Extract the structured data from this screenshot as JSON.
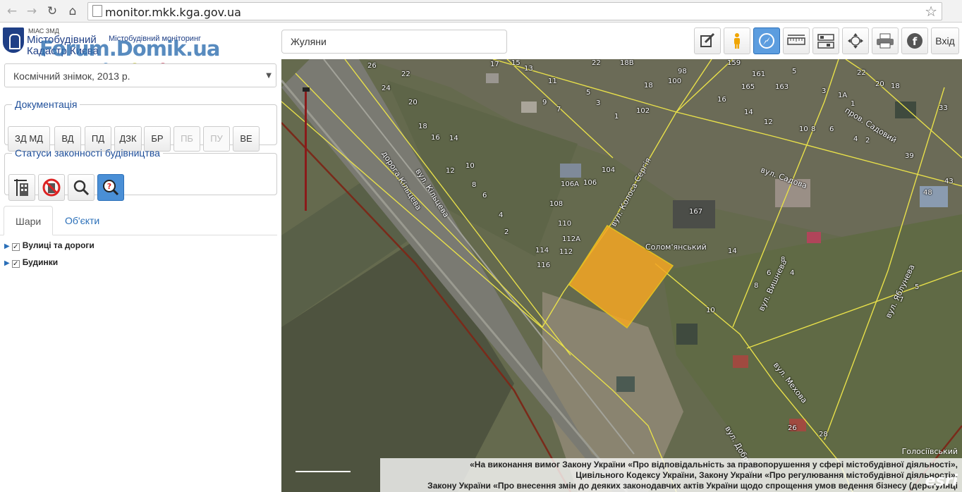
{
  "browser": {
    "url": "monitor.mkk.kga.gov.ua",
    "back_icon": "←",
    "forward_icon": "→",
    "reload_icon": "↻",
    "home_icon": "⌂",
    "star_icon": "☆"
  },
  "header": {
    "miac": "МІАС ЗМД",
    "brand_line1": "Містобудівний",
    "brand_line2": "Кадастр Києва",
    "subtitle": "Містобудівний моніторинг",
    "watermark": "Forum.Domik.ua"
  },
  "sidebar": {
    "basemap_selected": "Космічний знімок, 2013 р.",
    "documentation": {
      "legend": "Документація",
      "buttons": [
        "ЗД МД",
        "ВД",
        "ПД",
        "ДЗК",
        "БР",
        "ПБ",
        "ПУ",
        "ВЕ"
      ]
    },
    "statuses": {
      "legend": "Статуси законності будівництва"
    },
    "tabs": [
      "Шари",
      "Об'єкти"
    ],
    "layers": [
      "Вулиці та дороги",
      "Будинки"
    ]
  },
  "toolbar": {
    "search_value": "Жуляни",
    "login_label": "Вхід",
    "icons": [
      "edit-icon",
      "street-view-icon",
      "compass-icon",
      "ruler-icon",
      "layers-tool-icon",
      "pan-icon",
      "print-icon",
      "facebook-icon"
    ]
  },
  "map": {
    "streets": [
      "дорога Кільцева",
      "вул. Кільцева",
      "вул. Колоса Сергія",
      "вул. Садова",
      "пров. Садовий",
      "вул. Вишнева",
      "вул. Яблунева",
      "вул. Мехова",
      "вул. Доброго"
    ],
    "highlight_label": "Солом'янський",
    "district_label": "Голосіївський",
    "numbers": [
      "26",
      "22",
      "24",
      "20",
      "18",
      "16",
      "14",
      "17",
      "15",
      "13",
      "11",
      "9",
      "7",
      "5",
      "3",
      "1",
      "22",
      "18В",
      "98",
      "100",
      "102",
      "18",
      "12",
      "10",
      "8",
      "6",
      "4",
      "2",
      "106А",
      "106",
      "104",
      "108",
      "110",
      "112А",
      "112",
      "114",
      "116",
      "159",
      "161",
      "163",
      "165",
      "16",
      "14",
      "12",
      "10",
      "8",
      "6",
      "5",
      "3",
      "1А",
      "1",
      "4",
      "2",
      "22",
      "20",
      "18",
      "33",
      "39",
      "43",
      "48",
      "167",
      "14",
      "6",
      "8",
      "8",
      "4",
      "10",
      "5",
      "7",
      "26",
      "28"
    ],
    "legal_line1": "«На виконання вимог Закону України «Про відповідальність за правопорушення у сфері містобудівної діяльності»,",
    "legal_line2": "Цивільного Кодексу України, Закону України «Про регулювання містобудівної діяльності»,",
    "legal_line3": "Закону України «Про внесення змін до деяких законодавчих актів України щодо спрощення умов ведення бізнесу (дерегуляці",
    "esri": "esri"
  },
  "colors": {
    "accent": "#2a6fb8",
    "highlight": "#f5a623",
    "active_button": "#4a8fd6"
  }
}
